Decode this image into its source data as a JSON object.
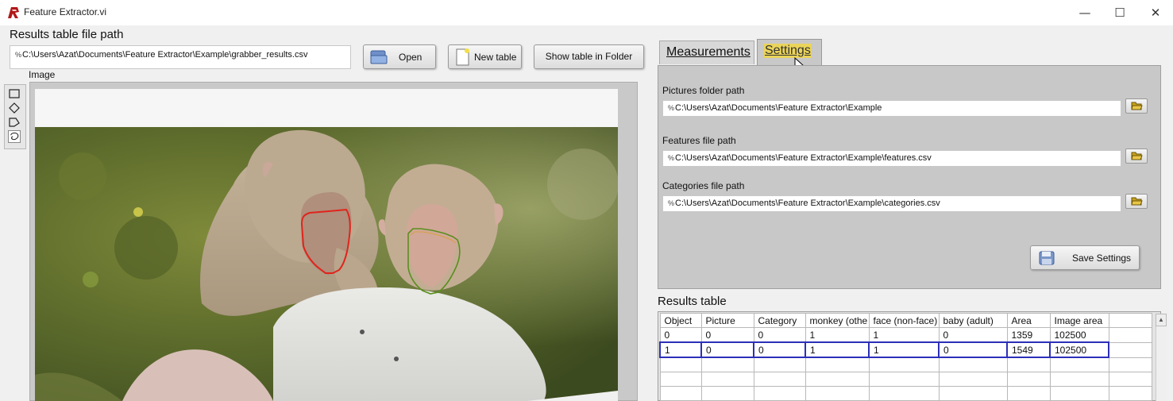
{
  "window": {
    "title": "Feature Extractor.vi",
    "minimize_glyph": "—",
    "maximize_glyph": "☐",
    "close_glyph": "✕"
  },
  "left": {
    "results_path_label": "Results table file path",
    "results_path_value": "C:\\Users\\Azat\\Documents\\Feature Extractor\\Example\\grabber_results.csv",
    "open_label": "Open",
    "new_table_label": "New table",
    "show_folder_label": "Show table in Folder",
    "image_label": "Image",
    "tools": [
      "rectangle-tool-icon",
      "rotated-rectangle-tool-icon",
      "polygon-tool-icon",
      "freehand-tool-icon"
    ]
  },
  "tabs": {
    "measurements": "Measurements",
    "settings": "Settings",
    "active": "Settings"
  },
  "settings": {
    "pictures_label": "Pictures folder path",
    "pictures_value": "C:\\Users\\Azat\\Documents\\Feature Extractor\\Example",
    "features_label": "Features file path",
    "features_value": "C:\\Users\\Azat\\Documents\\Feature Extractor\\Example\\features.csv",
    "categories_label": "Categories file path",
    "categories_value": "C:\\Users\\Azat\\Documents\\Feature Extractor\\Example\\categories.csv",
    "save_label": "Save Settings"
  },
  "results": {
    "label": "Results table",
    "columns": [
      "Object",
      "Picture",
      "Category",
      "monkey (othe",
      "face (non-face)",
      "baby (adult)",
      "Area",
      "Image area",
      ""
    ],
    "rows": [
      [
        "0",
        "0",
        "0",
        "1",
        "1",
        "0",
        "1359",
        "102500",
        ""
      ],
      [
        "1",
        "0",
        "0",
        "1",
        "1",
        "0",
        "1549",
        "102500",
        ""
      ]
    ],
    "selected_row": 1
  },
  "colors": {
    "selection_border": "#2d2fb8",
    "tab_highlight": "#ead45a",
    "roi_red": "#e0241c",
    "roi_green": "#5a8f1e"
  }
}
